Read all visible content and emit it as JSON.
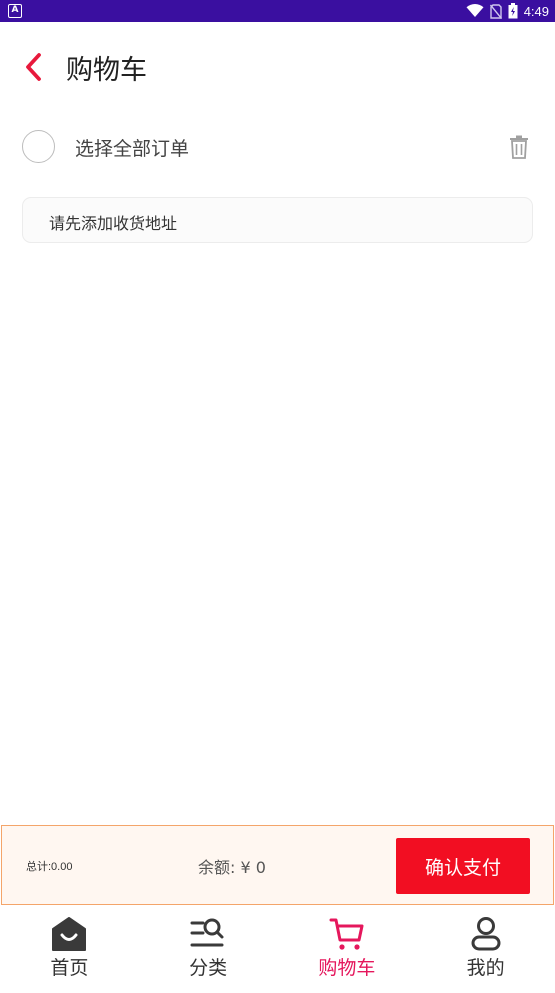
{
  "status_bar": {
    "app_badge": "A",
    "time": "4:49",
    "icons": [
      "wifi-icon",
      "no-sim-icon",
      "battery-icon"
    ]
  },
  "header": {
    "title": "购物车",
    "back_icon": "chevron-left-icon"
  },
  "select_all": {
    "label": "选择全部订单",
    "checked": false
  },
  "address": {
    "placeholder_text": "请先添加收货地址"
  },
  "checkout": {
    "total_label": "总计:0.00",
    "balance_label": "余额: ¥ 0",
    "pay_button": "确认支付"
  },
  "bottom_nav": {
    "items": [
      {
        "label": "首页",
        "icon": "home-icon",
        "active": false
      },
      {
        "label": "分类",
        "icon": "category-search-icon",
        "active": false
      },
      {
        "label": "购物车",
        "icon": "cart-icon",
        "active": true
      },
      {
        "label": "我的",
        "icon": "user-icon",
        "active": false
      }
    ]
  },
  "colors": {
    "status_bar": "#3a0fa0",
    "accent_red": "#f20e22",
    "active_nav": "#e5175c",
    "back_arrow": "#e8193c",
    "checkout_border": "#f4a56a",
    "checkout_bg": "#fff7f1"
  }
}
